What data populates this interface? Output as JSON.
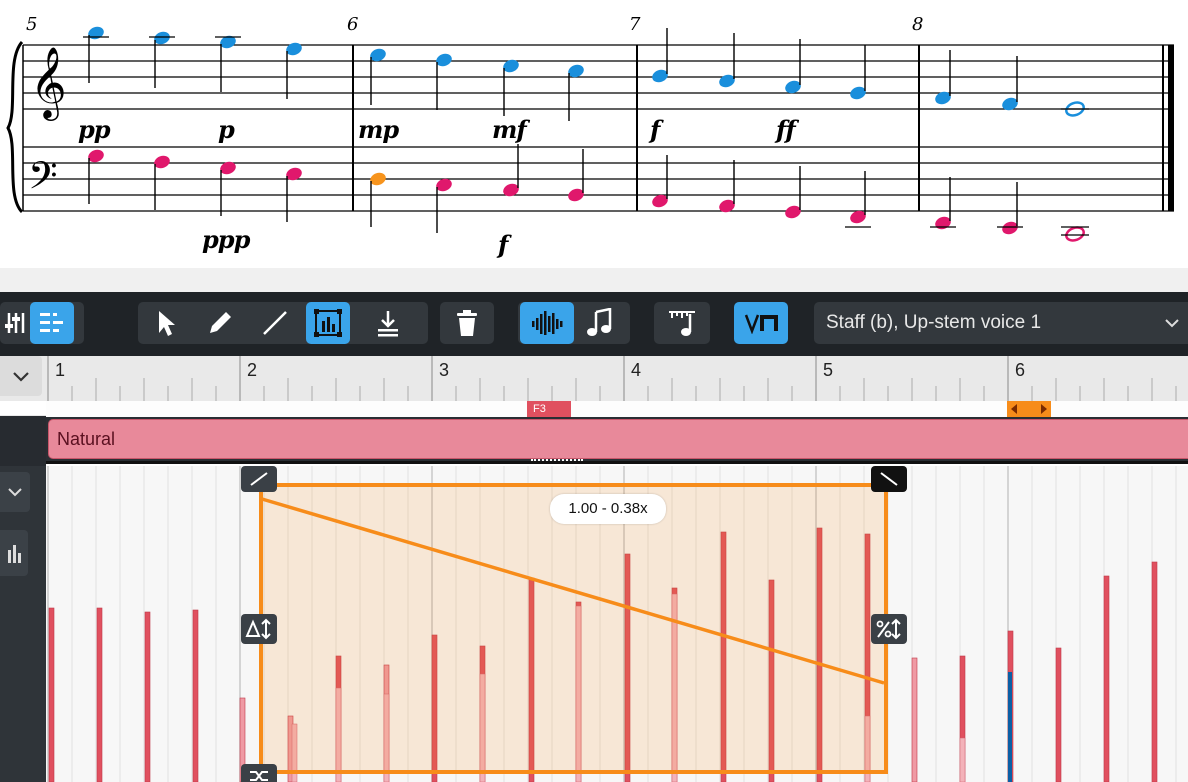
{
  "score": {
    "bar_numbers": [
      "5",
      "6",
      "7",
      "8"
    ],
    "dynamics_treble": [
      "pp",
      "p",
      "mp",
      "mf",
      "f",
      "ff"
    ],
    "dynamics_bass": [
      "ppp",
      "f"
    ]
  },
  "toolbar": {
    "voice_selector": "Staff (b), Up-stem voice 1",
    "tools": [
      "select-tool",
      "draw-tool",
      "line-tool",
      "transform-tool",
      "insert-tool",
      "delete-tool",
      "velocity-view",
      "note-view",
      "ruler-note-tool",
      "voice-toggle"
    ]
  },
  "ruler": {
    "bars": [
      "1",
      "2",
      "3",
      "4",
      "5",
      "6"
    ]
  },
  "cc_lane": {
    "marker_label": "F3",
    "playing_technique": "Natural"
  },
  "velocity_lane": {
    "scale_readout": "1.00 - 0.38x",
    "selection_from": 1.0,
    "selection_to": 0.38
  },
  "colors": {
    "treble_note": "#1a8fdc",
    "bass_note": "#e0186c",
    "selected_note": "#f7941d",
    "accent": "#3aa4ea",
    "selection_orange": "#f78c1a",
    "velocity_bar": "#e0505f",
    "technique_fill": "#e8899a"
  }
}
